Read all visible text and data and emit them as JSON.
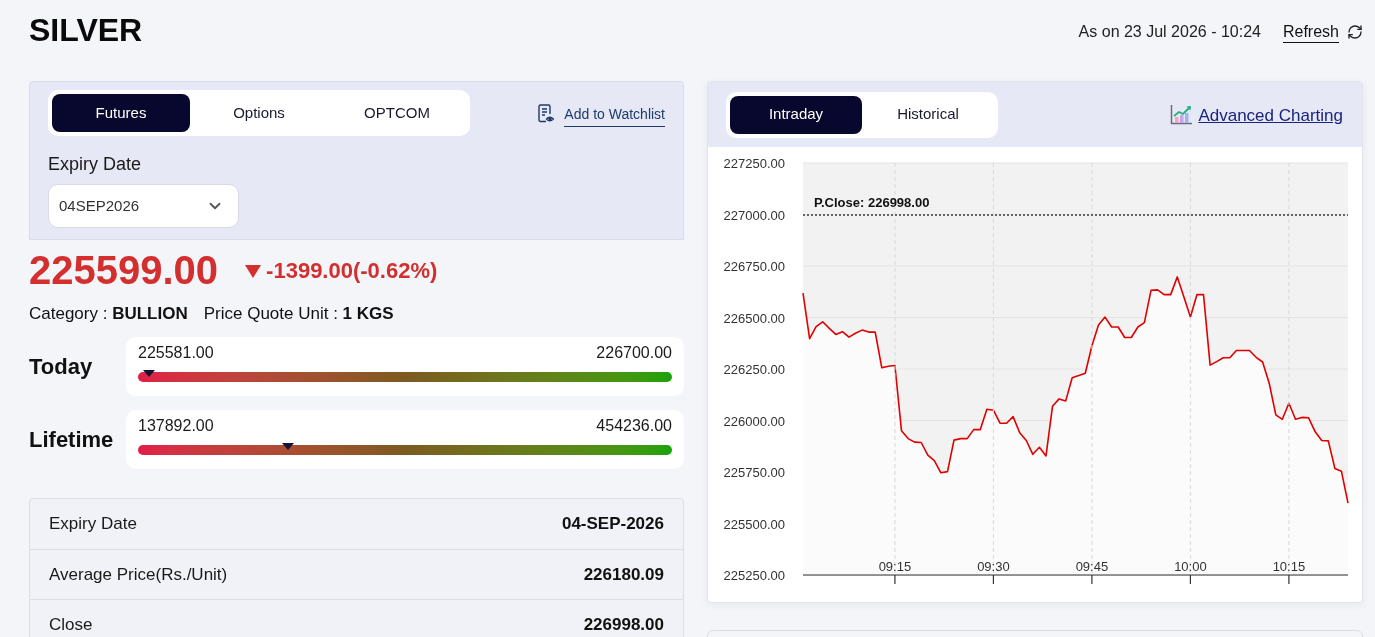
{
  "header": {
    "title": "SILVER",
    "as_on": "As on 23 Jul 2026 - 10:24",
    "refresh": "Refresh"
  },
  "contract_panel": {
    "tabs": [
      {
        "label": "Futures",
        "selected": true
      },
      {
        "label": "Options",
        "selected": false
      },
      {
        "label": "OPTCOM",
        "selected": false
      }
    ],
    "watchlist_link": "Add to Watchlist",
    "expiry_label": "Expiry Date",
    "expiry_select": {
      "value": "04SEP2026"
    }
  },
  "quote": {
    "price": "225599.00",
    "falling": true,
    "change": "-1399.00(-0.62%)",
    "category": "Category : **BULLION**",
    "unit": "Price Quote Unit : **1 KGS**"
  },
  "ranges": [
    {
      "label": "Today",
      "low": "225581.00",
      "high": "226700.00",
      "level": 0.02
    },
    {
      "label": "Lifetime",
      "low": "137892.00",
      "high": "454236.00",
      "level": 0.28
    }
  ],
  "details": [
    {
      "label": "Expiry Date",
      "value": "04-SEP-2026"
    },
    {
      "label": "Average Price(Rs./Unit)",
      "value": "226180.09"
    },
    {
      "label": "Close",
      "value": "226998.00"
    }
  ],
  "chart_panel": {
    "tabs": [
      {
        "label": "Intraday",
        "selected": true
      },
      {
        "label": "Historical",
        "selected": false
      }
    ],
    "advanced_link": "Advanced Charting",
    "chart_data": {
      "type": "area",
      "categories": [
        null,
        null,
        null,
        null,
        null,
        null,
        null,
        null,
        null,
        null,
        null,
        null,
        null,
        null,
        "09:15",
        null,
        null,
        null,
        null,
        null,
        null,
        null,
        null,
        null,
        null,
        null,
        null,
        null,
        null,
        "09:30",
        null,
        null,
        null,
        null,
        null,
        null,
        null,
        null,
        null,
        null,
        null,
        null,
        null,
        null,
        "09:45",
        null,
        null,
        null,
        null,
        null,
        null,
        null,
        null,
        null,
        null,
        null,
        null,
        null,
        null,
        "10:00",
        null,
        null,
        null,
        null,
        null,
        null,
        null,
        null,
        null,
        null,
        null,
        null,
        null,
        null,
        "10:15",
        null,
        null,
        null,
        null,
        null,
        null,
        null,
        null,
        null
      ],
      "series": [
        {
          "color": "#e00000",
          "values": [
            226618,
            226397,
            226456,
            226479,
            226447,
            226418,
            226431,
            226405,
            226424,
            226439,
            226429,
            226429,
            226256,
            226263,
            226267,
            225950,
            225912,
            225895,
            225893,
            225832,
            225805,
            225746,
            225752,
            225905,
            225912,
            225912,
            225956,
            225956,
            226055,
            226050,
            225987,
            225987,
            226019,
            225941,
            225903,
            225836,
            225870,
            225828,
            226069,
            226105,
            226095,
            226208,
            226218,
            226229,
            226363,
            226464,
            226502,
            226454,
            226454,
            226403,
            226403,
            226454,
            226475,
            226632,
            226634,
            226611,
            226611,
            226697,
            226601,
            226502,
            226611,
            226611,
            226269,
            226286,
            226305,
            226305,
            226340,
            226340,
            226340,
            226307,
            226284,
            226181,
            226027,
            226006,
            226084,
            226006,
            226015,
            226013,
            225945,
            225903,
            225901,
            225767,
            225754,
            225599
          ]
        }
      ],
      "ylim": [
        225250,
        227250
      ],
      "yticks": [
        {
          "value": 225250,
          "label": "225250.00"
        },
        {
          "value": 225500,
          "label": "225500.00"
        },
        {
          "value": 225750,
          "label": "225750.00"
        },
        {
          "value": 226000,
          "label": "226000.00"
        },
        {
          "value": 226250,
          "label": "226250.00"
        },
        {
          "value": 226500,
          "label": "226500.00"
        },
        {
          "value": 226750,
          "label": "226750.00"
        },
        {
          "value": 227000,
          "label": "227000.00"
        },
        {
          "value": 227250,
          "label": "227250.00"
        }
      ],
      "grid": true,
      "ref_lines": [
        {
          "axis": "y",
          "value": 226998,
          "label": "P.Close: 226998.00"
        }
      ]
    }
  }
}
